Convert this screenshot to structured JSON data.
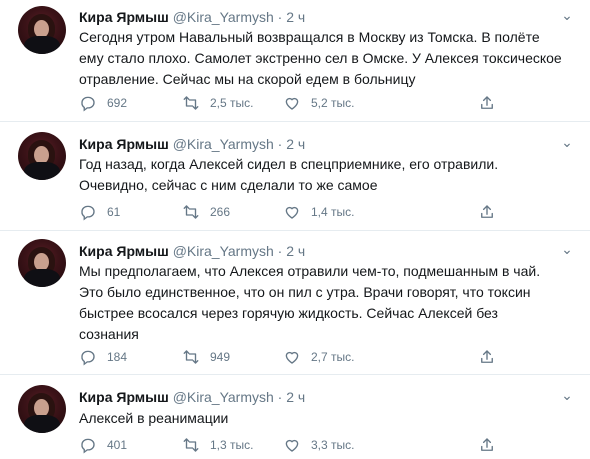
{
  "author": {
    "name": "Кира Ярмыш",
    "handle": "@Kira_Yarmysh"
  },
  "tweets": [
    {
      "time": "2 ч",
      "lines": [
        "Сегодня утром Навальный возвращался в Москву из Томска. В полёте",
        "ему стало плохо. Самолет экстренно сел в Омске. У Алексея токсическое",
        "отравление. Сейчас мы на скорой едем в больницу"
      ],
      "replies": "692",
      "retweets": "2,5 тыс.",
      "likes": "5,2 тыс."
    },
    {
      "time": "2 ч",
      "lines": [
        "Год назад, когда Алексей сидел в спецприемнике, его отравили.",
        "Очевидно, сейчас с ним сделали то же самое"
      ],
      "replies": "61",
      "retweets": "266",
      "likes": "1,4 тыс."
    },
    {
      "time": "2 ч",
      "lines": [
        "Мы предполагаем, что Алексея отравили чем-то, подмешанным в чай.",
        "Это было единственное, что он пил с утра. Врачи говорят, что токсин",
        "быстрее всосался через горячую жидкость. Сейчас Алексей без",
        "сознания"
      ],
      "replies": "184",
      "retweets": "949",
      "likes": "2,7 тыс."
    },
    {
      "time": "2 ч",
      "lines": [
        "Алексей в реанимации"
      ],
      "replies": "401",
      "retweets": "1,3 тыс.",
      "likes": "3,3 тыс."
    }
  ]
}
